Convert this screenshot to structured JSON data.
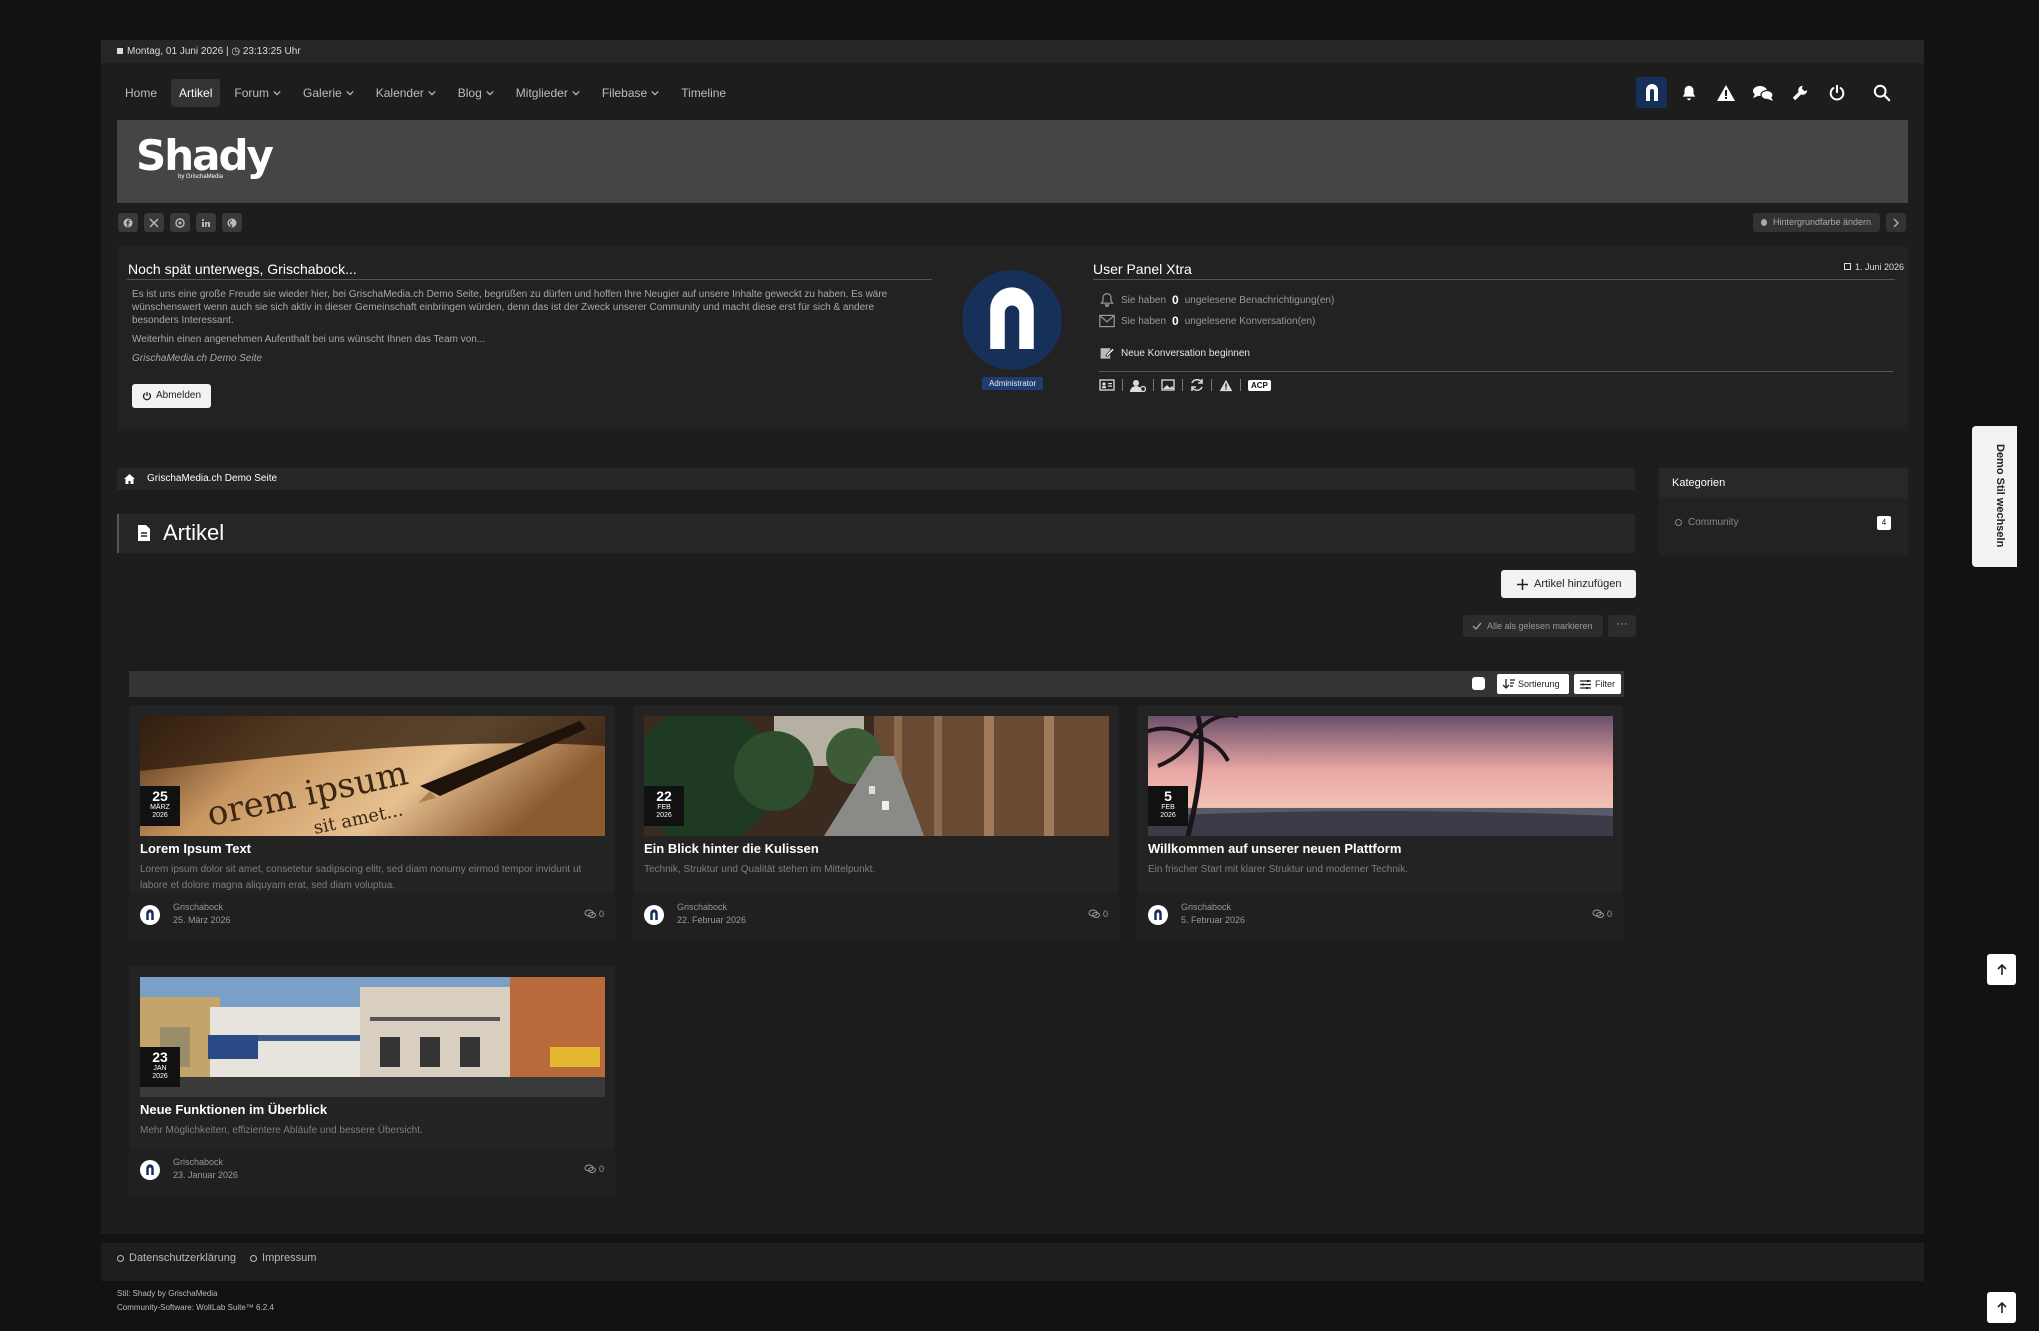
{
  "topbar": {
    "datetime": "Montag, 01 Juni 2026 | ◷ 23:13:25 Uhr"
  },
  "nav": {
    "items": [
      {
        "label": "Home",
        "dropdown": false,
        "active": false
      },
      {
        "label": "Artikel",
        "dropdown": false,
        "active": true
      },
      {
        "label": "Forum",
        "dropdown": true,
        "active": false
      },
      {
        "label": "Galerie",
        "dropdown": true,
        "active": false
      },
      {
        "label": "Kalender",
        "dropdown": true,
        "active": false
      },
      {
        "label": "Blog",
        "dropdown": true,
        "active": false
      },
      {
        "label": "Mitglieder",
        "dropdown": true,
        "active": false
      },
      {
        "label": "Filebase",
        "dropdown": true,
        "active": false
      },
      {
        "label": "Timeline",
        "dropdown": false,
        "active": false
      }
    ],
    "icons": [
      "user-avatar-icon",
      "bell-icon",
      "warning-icon",
      "comments-icon",
      "wrench-icon",
      "power-icon",
      "search-icon"
    ]
  },
  "header": {
    "logo": "Shady",
    "logo_sub": "by GrischaMedia",
    "bg_change": "Hintergrundfarbe ändern"
  },
  "social": [
    "facebook-icon",
    "x-icon",
    "threads-icon",
    "linkedin-icon",
    "pinterest-icon"
  ],
  "welcome": {
    "title": "Noch spät unterwegs, Grischabock...",
    "text1": "Es ist uns eine große Freude sie wieder hier, bei GrischaMedia.ch Demo Seite, begrüßen zu dürfen und hoffen Ihre Neugier auf unsere Inhalte geweckt zu haben. Es wäre wünschenswert wenn auch sie sich aktiv in dieser Gemeinschaft einbringen würden, denn das ist der Zweck unserer Community und macht diese erst für sich & andere besonders Interessant.",
    "text2": "Weiterhin einen angenehmen Aufenthalt bei uns wünscht Ihnen das Team von...",
    "signature": "GrischaMedia.ch Demo Seite",
    "logout": "Abmelden"
  },
  "user": {
    "badge": "Administrator"
  },
  "userpanel": {
    "title": "User Panel Xtra",
    "date": "1. Juni 2026",
    "notif_pre": "Sie haben",
    "notif_count": "0",
    "notif_post": "ungelesene Benachrichtigung(en)",
    "conv_pre": "Sie haben",
    "conv_count": "0",
    "conv_post": "ungelesene Konversation(en)",
    "new_conv": "Neue Konversation beginnen",
    "acp": "ACP"
  },
  "breadcrumb": "GrischaMedia.ch Demo Seite",
  "page": {
    "title": "Artikel",
    "add_button": "Artikel hinzufügen",
    "mark_read": "Alle als gelesen markieren",
    "more": "···",
    "sort": "Sortierung",
    "filter": "Filter"
  },
  "articles": [
    {
      "day": "25",
      "month": "MÄRZ",
      "year": "2026",
      "title": "Lorem Ipsum Text",
      "desc": "Lorem ipsum dolor sit amet, consetetur sadipscing elitr, sed diam nonumy eirmod tempor invidunt ut labore et dolore magna aliquyam erat, sed diam voluptua.",
      "author": "Grischabock",
      "date": "25. März 2026",
      "comments": "0"
    },
    {
      "day": "22",
      "month": "FEB",
      "year": "2026",
      "title": "Ein Blick hinter die Kulissen",
      "desc": "Technik, Struktur und Qualität stehen im Mittelpunkt.",
      "author": "Grischabock",
      "date": "22. Februar 2026",
      "comments": "0"
    },
    {
      "day": "5",
      "month": "FEB",
      "year": "2026",
      "title": "Willkommen auf unserer neuen Plattform",
      "desc": "Ein frischer Start mit klarer Struktur und moderner Technik.",
      "author": "Grischabock",
      "date": "5. Februar 2026",
      "comments": "0"
    },
    {
      "day": "23",
      "month": "JAN",
      "year": "2026",
      "title": "Neue Funktionen im Überblick",
      "desc": "Mehr Möglichkeiten, effizientere Abläufe und bessere Übersicht.",
      "author": "Grischabock",
      "date": "23. Januar 2026",
      "comments": "0"
    }
  ],
  "sidebar": {
    "title": "Kategorien",
    "items": [
      {
        "label": "Community",
        "count": "4"
      }
    ]
  },
  "demo_tab": "Demo Stil wechseln",
  "footer": {
    "links": [
      "Datenschutzerklärung",
      "Impressum"
    ],
    "style": "Stil: Shady by GrischaMedia",
    "software": "Community-Software: WoltLab Suite™ 6.2.4"
  }
}
